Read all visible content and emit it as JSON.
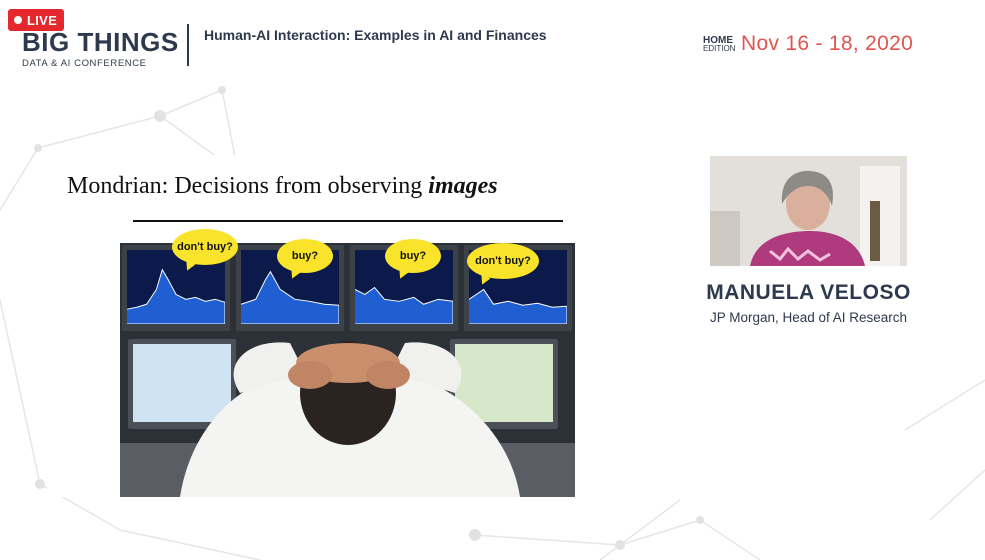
{
  "header": {
    "live_label": "LIVE",
    "logo_main": "BIG THINGS",
    "logo_sub": "DATA & AI CONFERENCE",
    "talk_title": "Human-AI Interaction: Examples in AI and Finances",
    "edition_line1": "HOME",
    "edition_line2": "EDITION",
    "event_dates": "Nov 16 - 18, 2020"
  },
  "slide": {
    "title_prefix": "Mondrian: Decisions from observing ",
    "title_emphasis": "images",
    "bubbles": [
      "don't buy?",
      "buy?",
      "buy?",
      "don't buy?"
    ]
  },
  "speaker": {
    "name": "MANUELA VELOSO",
    "role": "JP Morgan, Head of AI Research"
  },
  "colors": {
    "live_red": "#e4282e",
    "brand_navy": "#2d3a4d",
    "date_coral": "#e0554f",
    "bubble_yellow": "#f9e42b"
  }
}
